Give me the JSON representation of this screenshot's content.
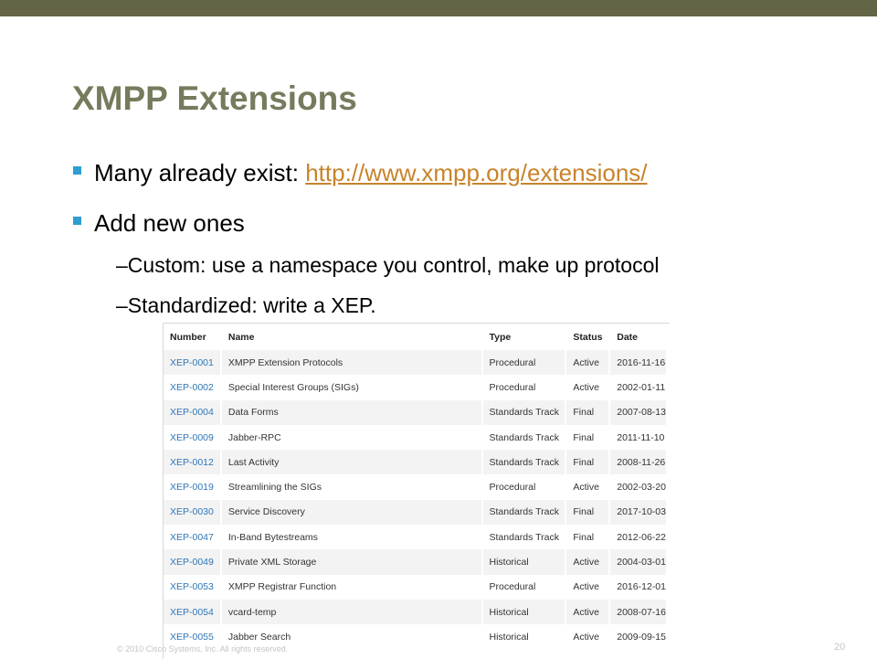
{
  "slide": {
    "title": "XMPP Extensions",
    "bullets": [
      {
        "text": "Many already exist: ",
        "link": "http://www.xmpp.org/extensions/"
      },
      {
        "text": "Add new ones"
      }
    ],
    "sub_bullets": [
      "–Custom: use a namespace you control, make up protocol",
      "–Standardized: write a XEP."
    ],
    "footer": {
      "copyright": "© 2010 Cisco Systems, Inc. All rights reserved.",
      "page_number": "20"
    },
    "colors": {
      "accent_bar": "#646446",
      "title": "#777a5c",
      "bullet": "#2f9ed0",
      "link": "#c8832b",
      "xep_link": "#2f76b6"
    }
  },
  "table": {
    "headers": [
      "Number",
      "Name",
      "Type",
      "Status",
      "Date"
    ],
    "rows": [
      [
        "XEP-0001",
        "XMPP Extension Protocols",
        "Procedural",
        "Active",
        "2016-11-16"
      ],
      [
        "XEP-0002",
        "Special Interest Groups (SIGs)",
        "Procedural",
        "Active",
        "2002-01-11"
      ],
      [
        "XEP-0004",
        "Data Forms",
        "Standards Track",
        "Final",
        "2007-08-13"
      ],
      [
        "XEP-0009",
        "Jabber-RPC",
        "Standards Track",
        "Final",
        "2011-11-10"
      ],
      [
        "XEP-0012",
        "Last Activity",
        "Standards Track",
        "Final",
        "2008-11-26"
      ],
      [
        "XEP-0019",
        "Streamlining the SIGs",
        "Procedural",
        "Active",
        "2002-03-20"
      ],
      [
        "XEP-0030",
        "Service Discovery",
        "Standards Track",
        "Final",
        "2017-10-03"
      ],
      [
        "XEP-0047",
        "In-Band Bytestreams",
        "Standards Track",
        "Final",
        "2012-06-22"
      ],
      [
        "XEP-0049",
        "Private XML Storage",
        "Historical",
        "Active",
        "2004-03-01"
      ],
      [
        "XEP-0053",
        "XMPP Registrar Function",
        "Procedural",
        "Active",
        "2016-12-01"
      ],
      [
        "XEP-0054",
        "vcard-temp",
        "Historical",
        "Active",
        "2008-07-16"
      ],
      [
        "XEP-0055",
        "Jabber Search",
        "Historical",
        "Active",
        "2009-09-15"
      ]
    ]
  }
}
